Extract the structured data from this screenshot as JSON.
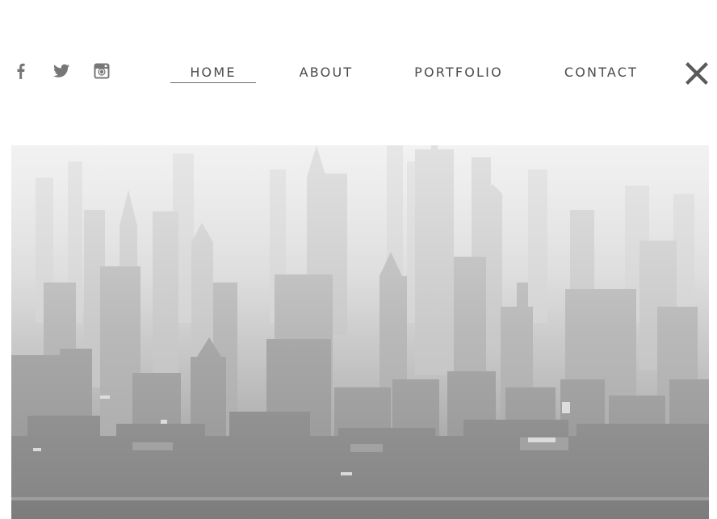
{
  "social": [
    {
      "name": "facebook",
      "icon": "facebook-icon"
    },
    {
      "name": "twitter",
      "icon": "twitter-icon"
    },
    {
      "name": "instagram",
      "icon": "instagram-icon"
    }
  ],
  "nav": {
    "items": [
      {
        "label": "HOME",
        "active": true
      },
      {
        "label": "ABOUT",
        "active": false
      },
      {
        "label": "PORTFOLIO",
        "active": false
      },
      {
        "label": "CONTACT",
        "active": false
      }
    ]
  },
  "menu_close": {
    "icon": "close-icon"
  },
  "hero": {
    "subject": "hazy city skyline"
  },
  "colors": {
    "nav_text": "#4b4b4b",
    "icon_gray": "#777777",
    "underline": "#6a6a6a"
  }
}
